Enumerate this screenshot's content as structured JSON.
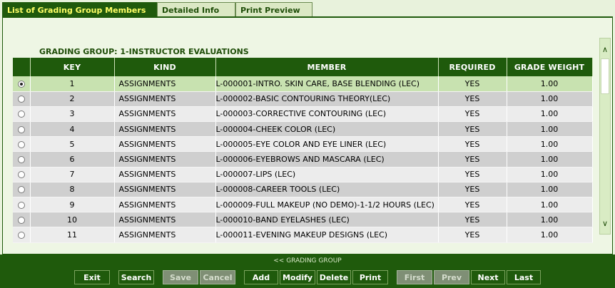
{
  "tabs": [
    {
      "label": "List of Grading Group Members",
      "active": true
    },
    {
      "label": "Detailed Info",
      "active": false
    },
    {
      "label": "Print Preview",
      "active": false
    }
  ],
  "group": {
    "label": "GRADING GROUP:",
    "value": "1-INSTRUCTOR EVALUATIONS"
  },
  "table": {
    "columns": [
      "KEY",
      "KIND",
      "MEMBER",
      "REQUIRED",
      "GRADE WEIGHT"
    ],
    "rows": [
      {
        "key": "1",
        "kind": "ASSIGNMENTS",
        "member": "L-000001-INTRO. SKIN CARE, BASE BLENDING (LEC)",
        "required": "YES",
        "weight": "1.00",
        "selected": true
      },
      {
        "key": "2",
        "kind": "ASSIGNMENTS",
        "member": "L-000002-BASIC CONTOURING THEORY(LEC)",
        "required": "YES",
        "weight": "1.00"
      },
      {
        "key": "3",
        "kind": "ASSIGNMENTS",
        "member": "L-000003-CORRECTIVE CONTOURING (LEC)",
        "required": "YES",
        "weight": "1.00"
      },
      {
        "key": "4",
        "kind": "ASSIGNMENTS",
        "member": "L-000004-CHEEK COLOR (LEC)",
        "required": "YES",
        "weight": "1.00"
      },
      {
        "key": "5",
        "kind": "ASSIGNMENTS",
        "member": "L-000005-EYE COLOR AND EYE LINER (LEC)",
        "required": "YES",
        "weight": "1.00"
      },
      {
        "key": "6",
        "kind": "ASSIGNMENTS",
        "member": "L-000006-EYEBROWS AND MASCARA (LEC)",
        "required": "YES",
        "weight": "1.00"
      },
      {
        "key": "7",
        "kind": "ASSIGNMENTS",
        "member": "L-000007-LIPS (LEC)",
        "required": "YES",
        "weight": "1.00"
      },
      {
        "key": "8",
        "kind": "ASSIGNMENTS",
        "member": "L-000008-CAREER TOOLS (LEC)",
        "required": "YES",
        "weight": "1.00"
      },
      {
        "key": "9",
        "kind": "ASSIGNMENTS",
        "member": "L-000009-FULL MAKEUP (NO DEMO)-1-1/2 HOURS (LEC)",
        "required": "YES",
        "weight": "1.00"
      },
      {
        "key": "10",
        "kind": "ASSIGNMENTS",
        "member": "L-000010-BAND EYELASHES (LEC)",
        "required": "YES",
        "weight": "1.00"
      },
      {
        "key": "11",
        "kind": "ASSIGNMENTS",
        "member": "L-000011-EVENING MAKEUP DESIGNS (LEC)",
        "required": "YES",
        "weight": "1.00"
      }
    ]
  },
  "scrollbar": {
    "up_icon": "chevron-up-icon",
    "down_icon": "chevron-down-icon"
  },
  "nav_link": "<< GRADING GROUP",
  "toolbar": {
    "exit": "Exit",
    "search": "Search",
    "save": "Save",
    "cancel": "Cancel",
    "add": "Add",
    "modify": "Modify",
    "delete": "Delete",
    "print": "Print",
    "first": "First",
    "prev": "Prev",
    "next": "Next",
    "last": "Last"
  },
  "colors": {
    "header_green": "#1f5a0c",
    "tab_active_text": "#ffff66",
    "row_selected": "#c8e2b0"
  }
}
